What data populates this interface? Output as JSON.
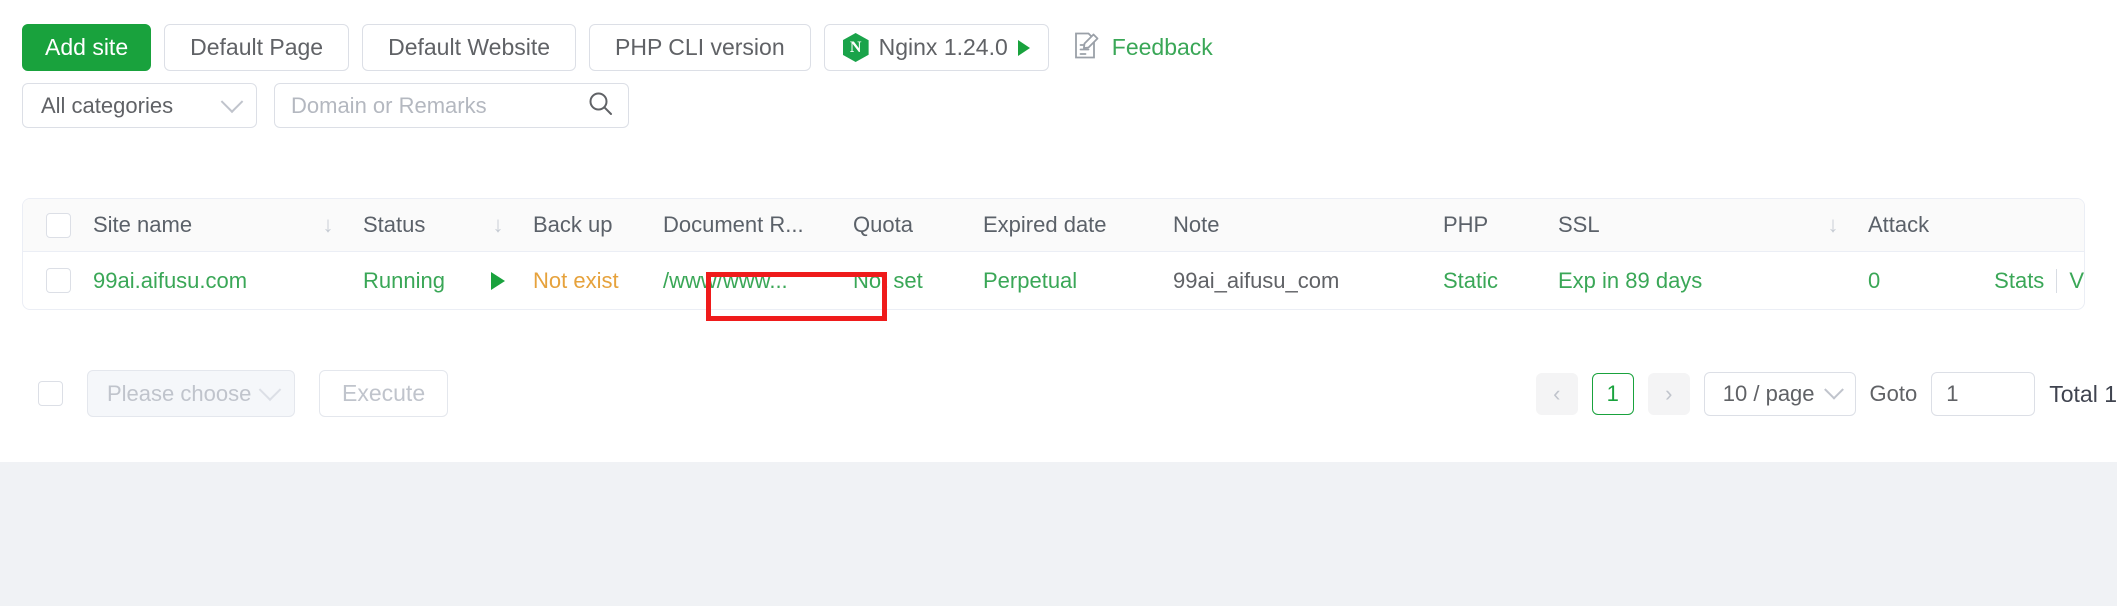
{
  "toolbar": {
    "add_site": "Add site",
    "default_page": "Default Page",
    "default_website": "Default Website",
    "php_cli_version": "PHP CLI version",
    "nginx": "Nginx 1.24.0",
    "nginx_badge_letter": "N",
    "feedback": "Feedback"
  },
  "filters": {
    "category_value": "All categories",
    "search_placeholder": "Domain or Remarks"
  },
  "table": {
    "headers": {
      "site_name": "Site name",
      "status": "Status",
      "backup": "Back up",
      "document_root": "Document R...",
      "quota": "Quota",
      "expired_date": "Expired date",
      "note": "Note",
      "php": "PHP",
      "ssl": "SSL",
      "attack": "Attack"
    },
    "sort_glyph": "↓",
    "rows": [
      {
        "site_name": "99ai.aifusu.com",
        "status": "Running",
        "backup": "Not exist",
        "document_root": "/www/www...",
        "quota": "Not set",
        "expired_date": "Perpetual",
        "note": "99ai_aifusu_com",
        "php": "Static",
        "ssl": "Exp in 89 days",
        "attack": "0",
        "op_stats": "Stats",
        "op_next": "V"
      }
    ]
  },
  "footer": {
    "batch_placeholder": "Please choose",
    "execute": "Execute",
    "prev": "‹",
    "next": "›",
    "current_page": "1",
    "page_size": "10 / page",
    "goto_label": "Goto",
    "goto_value": "1",
    "total": "Total 1"
  },
  "colors": {
    "primary_green": "#19a23d",
    "link_green": "#3aa757",
    "warning_orange": "#e6a23c",
    "highlight_red": "#ef1b1b",
    "page_background": "#f0f2f5"
  }
}
